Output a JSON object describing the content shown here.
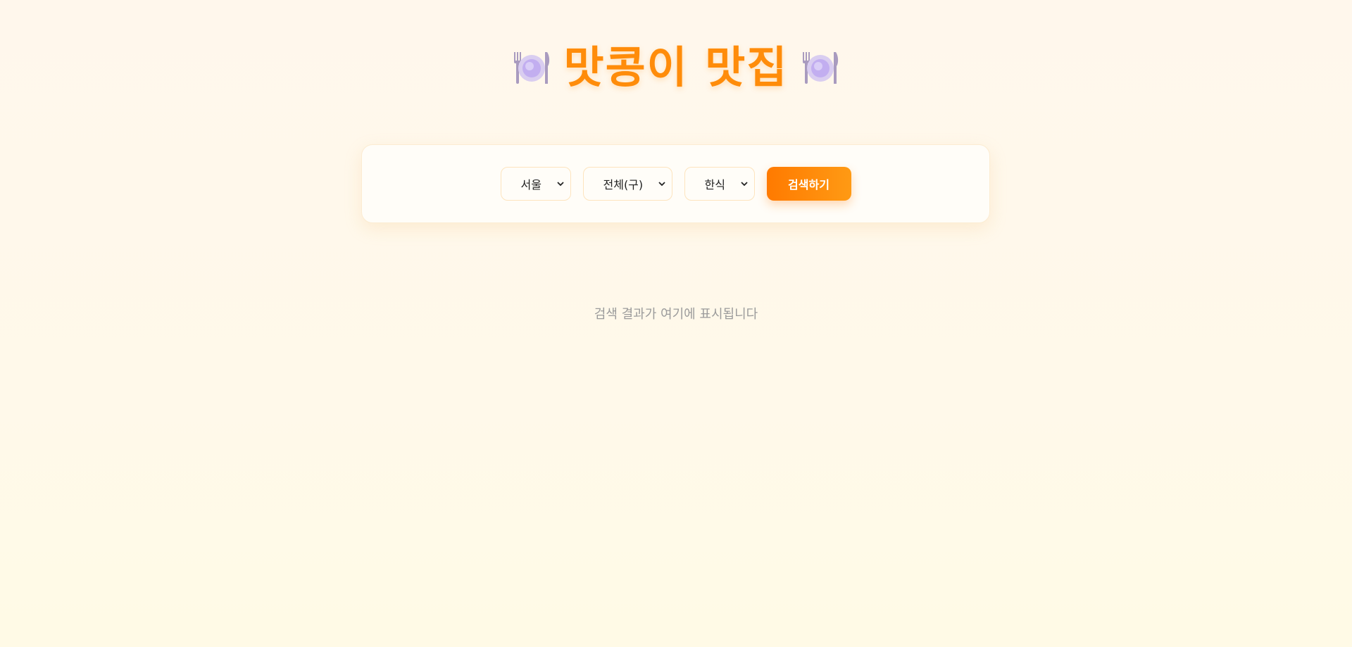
{
  "header": {
    "title": "맛콩이 맛집",
    "left_icon": "plate-with-cutlery-icon",
    "right_icon": "plate-with-cutlery-icon"
  },
  "search": {
    "city": {
      "selected": "서울"
    },
    "district": {
      "selected": "전체(구)"
    },
    "cuisine": {
      "selected": "한식"
    },
    "button_label": "검색하기"
  },
  "results": {
    "placeholder": "검색 결과가 여기에 표시됩니다"
  },
  "colors": {
    "accent": "#ff8c0a",
    "button_start": "#ff7a00",
    "button_end": "#ff9a14",
    "background": "#fff8ea",
    "muted_text": "#9b9b9b"
  }
}
